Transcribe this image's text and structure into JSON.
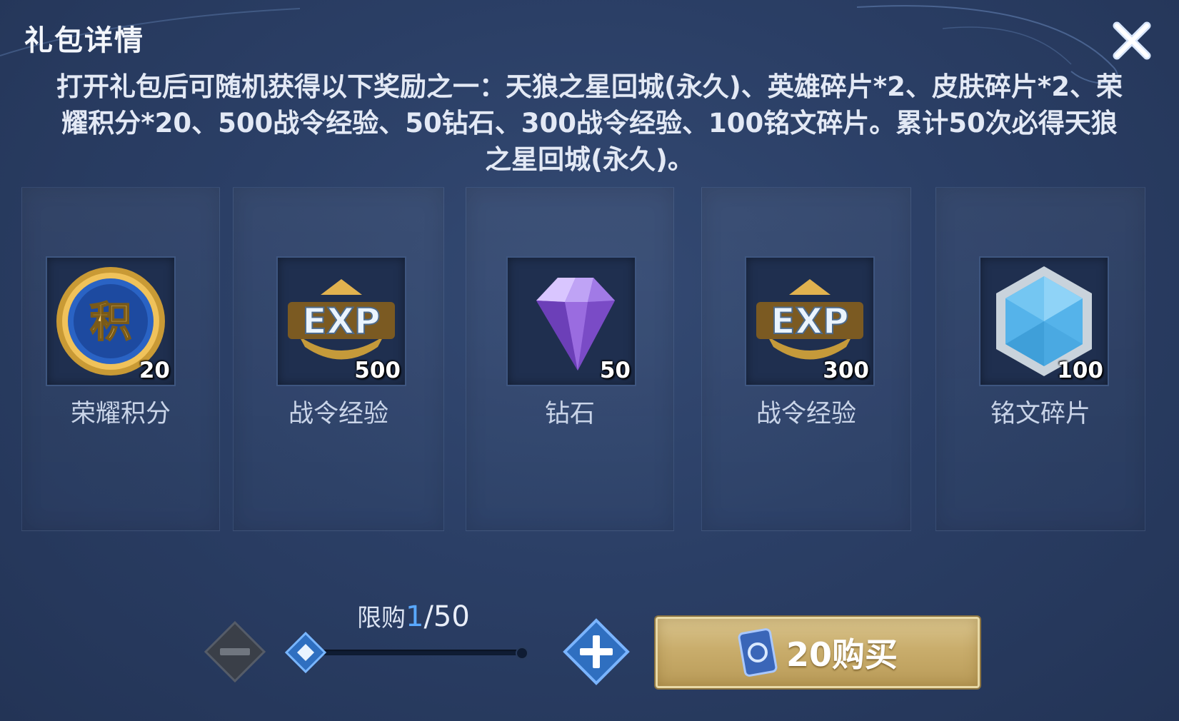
{
  "dialog": {
    "title": "礼包详情",
    "close_icon": "close-icon",
    "description": "打开礼包后可随机获得以下奖励之一：天狼之星回城(永久)、英雄碎片*2、皮肤碎片*2、荣耀积分*20、500战令经验、50钻石、300战令经验、100铭文碎片。累计50次必得天狼之星回城(永久)。"
  },
  "rewards": [
    {
      "name": "荣耀积分",
      "count": "20",
      "icon": "honor-points-icon"
    },
    {
      "name": "战令经验",
      "count": "500",
      "icon": "exp-icon"
    },
    {
      "name": "钻石",
      "count": "50",
      "icon": "diamond-icon"
    },
    {
      "name": "战令经验",
      "count": "300",
      "icon": "exp-icon"
    },
    {
      "name": "铭文碎片",
      "count": "100",
      "icon": "inscription-fragment-icon"
    }
  ],
  "purchase": {
    "limit_label": "限购",
    "limit_current": "1",
    "limit_max": "/50",
    "slider_value": 1,
    "slider_max": 50,
    "buy_label": "20购买",
    "currency_icon": "coupon-ticket-icon"
  },
  "colors": {
    "background": "#2b3f66",
    "accent_blue": "#59a8ff",
    "buy_gold": "#c9ad6c"
  }
}
